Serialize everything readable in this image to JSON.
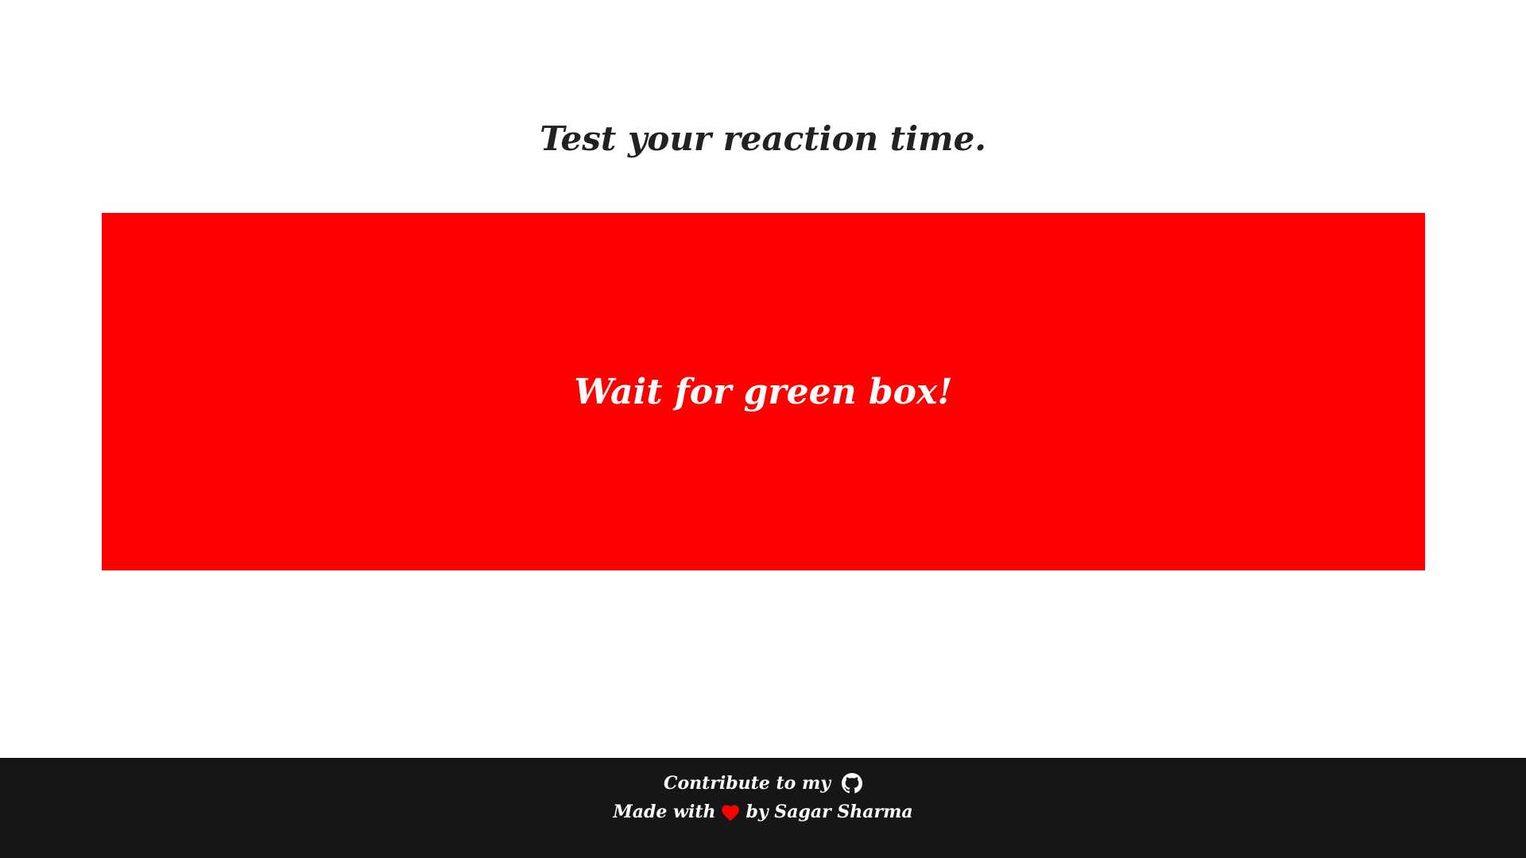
{
  "page": {
    "title": "Test your reaction time."
  },
  "reaction_box": {
    "message": "Wait for green box!",
    "state_color": "#ff0000"
  },
  "footer": {
    "contribute_text": "Contribute to my",
    "github_icon": "github-icon",
    "made_with_text": "Made with",
    "heart_icon": "heart-icon",
    "heart_color": "#ff0000",
    "by_text": "by Sagar Sharma",
    "background": "#161616"
  }
}
